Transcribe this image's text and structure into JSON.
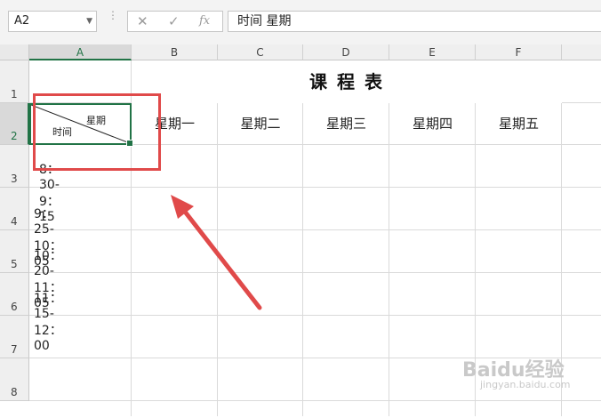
{
  "formula_bar": {
    "name_box": "A2",
    "cancel_icon": "✕",
    "enter_icon": "✓",
    "fx_label": "fx",
    "formula_text": "时间 星期"
  },
  "columns": [
    "A",
    "B",
    "C",
    "D",
    "E",
    "F"
  ],
  "rows": [
    "1",
    "2",
    "3",
    "4",
    "5",
    "6",
    "7",
    "8"
  ],
  "sheet": {
    "title": "课 程 表",
    "a2_top_right": "星期",
    "a2_bottom_left": "时间",
    "days": [
      "星期一",
      "星期二",
      "星期三",
      "星期四",
      "星期五"
    ],
    "times": [
      "8：30-9：15",
      "9：25-10：05",
      "10：20-11：05",
      "11：15-12：00"
    ]
  },
  "watermark": {
    "text": "Baidu经验",
    "sub": "jingyan.baidu.com"
  },
  "colors": {
    "selection": "#217346",
    "annotation": "#e04a4a"
  }
}
